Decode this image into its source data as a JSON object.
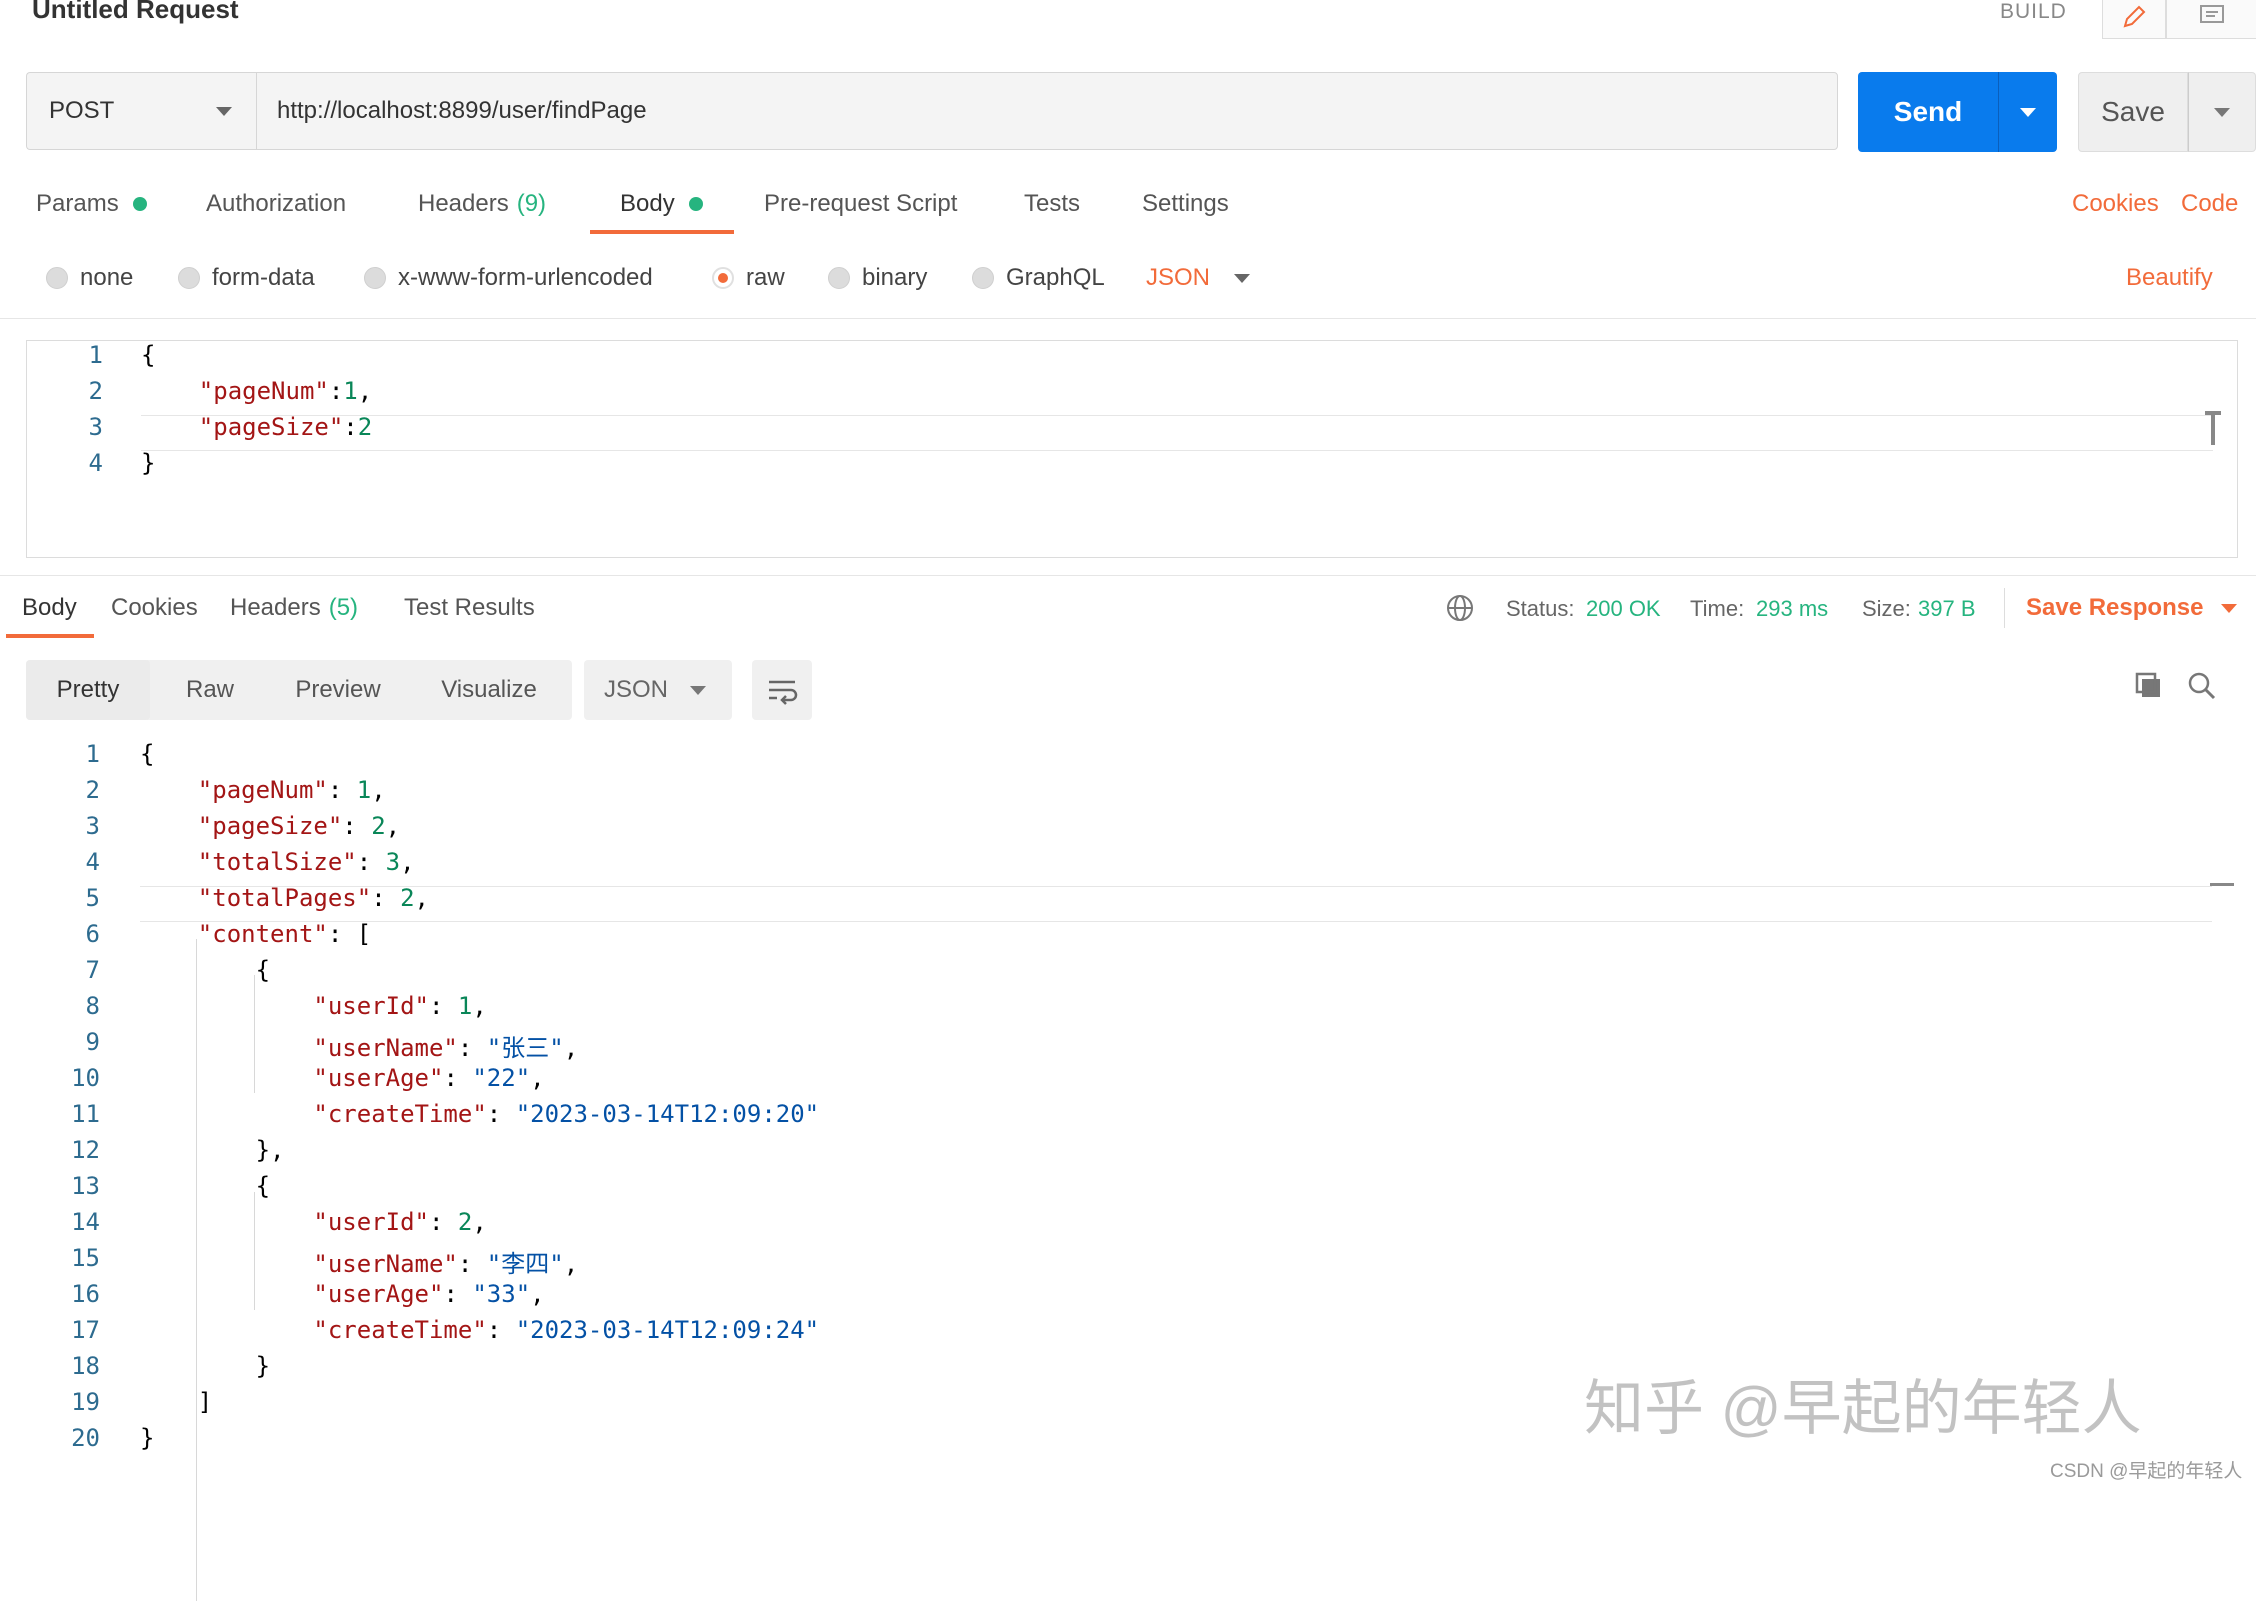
{
  "header": {
    "title": "Untitled Request",
    "mode": "BUILD",
    "edit_icon": "pencil-icon",
    "comment_icon": "comment-icon"
  },
  "request": {
    "method": "POST",
    "url": "http://localhost:8899/user/findPage",
    "send_label": "Send",
    "save_label": "Save"
  },
  "request_tabs": [
    {
      "label": "Params",
      "indicator": "dot"
    },
    {
      "label": "Authorization"
    },
    {
      "label": "Headers",
      "count": "(9)"
    },
    {
      "label": "Body",
      "indicator": "dot",
      "active": true
    },
    {
      "label": "Pre-request Script"
    },
    {
      "label": "Tests"
    },
    {
      "label": "Settings"
    }
  ],
  "request_links": {
    "cookies": "Cookies",
    "code": "Code"
  },
  "body_types": {
    "options": [
      "none",
      "form-data",
      "x-www-form-urlencoded",
      "raw",
      "binary",
      "GraphQL"
    ],
    "selected": "raw",
    "format": "JSON",
    "beautify": "Beautify"
  },
  "request_body_lines": [
    {
      "no": "1",
      "parts": [
        {
          "t": "p",
          "v": "{"
        }
      ]
    },
    {
      "no": "2",
      "parts": [
        {
          "t": "p",
          "v": "    "
        },
        {
          "t": "k",
          "v": "\"pageNum\""
        },
        {
          "t": "p",
          "v": ":"
        },
        {
          "t": "n",
          "v": "1"
        },
        {
          "t": "p",
          "v": ","
        }
      ]
    },
    {
      "no": "3",
      "parts": [
        {
          "t": "p",
          "v": "    "
        },
        {
          "t": "k",
          "v": "\"pageSize\""
        },
        {
          "t": "p",
          "v": ":"
        },
        {
          "t": "n",
          "v": "2"
        }
      ]
    },
    {
      "no": "4",
      "parts": [
        {
          "t": "p",
          "v": "}"
        }
      ]
    }
  ],
  "response_tabs": [
    {
      "label": "Body",
      "active": true
    },
    {
      "label": "Cookies"
    },
    {
      "label": "Headers",
      "count": "(5)"
    },
    {
      "label": "Test Results"
    }
  ],
  "response_status": {
    "status_label": "Status:",
    "status": "200 OK",
    "time_label": "Time:",
    "time": "293 ms",
    "size_label": "Size:",
    "size": "397 B",
    "save_response": "Save Response"
  },
  "response_view": {
    "modes": [
      "Pretty",
      "Raw",
      "Preview",
      "Visualize"
    ],
    "selected": "Pretty",
    "format": "JSON"
  },
  "response_body_lines": [
    {
      "no": "1",
      "parts": [
        {
          "t": "p",
          "v": "{"
        }
      ]
    },
    {
      "no": "2",
      "parts": [
        {
          "t": "p",
          "v": "    "
        },
        {
          "t": "k",
          "v": "\"pageNum\""
        },
        {
          "t": "p",
          "v": ": "
        },
        {
          "t": "n",
          "v": "1"
        },
        {
          "t": "p",
          "v": ","
        }
      ]
    },
    {
      "no": "3",
      "parts": [
        {
          "t": "p",
          "v": "    "
        },
        {
          "t": "k",
          "v": "\"pageSize\""
        },
        {
          "t": "p",
          "v": ": "
        },
        {
          "t": "n",
          "v": "2"
        },
        {
          "t": "p",
          "v": ","
        }
      ]
    },
    {
      "no": "4",
      "parts": [
        {
          "t": "p",
          "v": "    "
        },
        {
          "t": "k",
          "v": "\"totalSize\""
        },
        {
          "t": "p",
          "v": ": "
        },
        {
          "t": "n",
          "v": "3"
        },
        {
          "t": "p",
          "v": ","
        }
      ]
    },
    {
      "no": "5",
      "parts": [
        {
          "t": "p",
          "v": "    "
        },
        {
          "t": "k",
          "v": "\"totalPages\""
        },
        {
          "t": "p",
          "v": ": "
        },
        {
          "t": "n",
          "v": "2"
        },
        {
          "t": "p",
          "v": ","
        }
      ]
    },
    {
      "no": "6",
      "parts": [
        {
          "t": "p",
          "v": "    "
        },
        {
          "t": "k",
          "v": "\"content\""
        },
        {
          "t": "p",
          "v": ": ["
        }
      ]
    },
    {
      "no": "7",
      "parts": [
        {
          "t": "p",
          "v": "        {"
        }
      ]
    },
    {
      "no": "8",
      "parts": [
        {
          "t": "p",
          "v": "            "
        },
        {
          "t": "k",
          "v": "\"userId\""
        },
        {
          "t": "p",
          "v": ": "
        },
        {
          "t": "n",
          "v": "1"
        },
        {
          "t": "p",
          "v": ","
        }
      ]
    },
    {
      "no": "9",
      "parts": [
        {
          "t": "p",
          "v": "            "
        },
        {
          "t": "k",
          "v": "\"userName\""
        },
        {
          "t": "p",
          "v": ": "
        },
        {
          "t": "s",
          "v": "\"张三\""
        },
        {
          "t": "p",
          "v": ","
        }
      ]
    },
    {
      "no": "10",
      "parts": [
        {
          "t": "p",
          "v": "            "
        },
        {
          "t": "k",
          "v": "\"userAge\""
        },
        {
          "t": "p",
          "v": ": "
        },
        {
          "t": "s",
          "v": "\"22\""
        },
        {
          "t": "p",
          "v": ","
        }
      ]
    },
    {
      "no": "11",
      "parts": [
        {
          "t": "p",
          "v": "            "
        },
        {
          "t": "k",
          "v": "\"createTime\""
        },
        {
          "t": "p",
          "v": ": "
        },
        {
          "t": "s",
          "v": "\"2023-03-14T12:09:20\""
        }
      ]
    },
    {
      "no": "12",
      "parts": [
        {
          "t": "p",
          "v": "        },"
        }
      ]
    },
    {
      "no": "13",
      "parts": [
        {
          "t": "p",
          "v": "        {"
        }
      ]
    },
    {
      "no": "14",
      "parts": [
        {
          "t": "p",
          "v": "            "
        },
        {
          "t": "k",
          "v": "\"userId\""
        },
        {
          "t": "p",
          "v": ": "
        },
        {
          "t": "n",
          "v": "2"
        },
        {
          "t": "p",
          "v": ","
        }
      ]
    },
    {
      "no": "15",
      "parts": [
        {
          "t": "p",
          "v": "            "
        },
        {
          "t": "k",
          "v": "\"userName\""
        },
        {
          "t": "p",
          "v": ": "
        },
        {
          "t": "s",
          "v": "\"李四\""
        },
        {
          "t": "p",
          "v": ","
        }
      ]
    },
    {
      "no": "16",
      "parts": [
        {
          "t": "p",
          "v": "            "
        },
        {
          "t": "k",
          "v": "\"userAge\""
        },
        {
          "t": "p",
          "v": ": "
        },
        {
          "t": "s",
          "v": "\"33\""
        },
        {
          "t": "p",
          "v": ","
        }
      ]
    },
    {
      "no": "17",
      "parts": [
        {
          "t": "p",
          "v": "            "
        },
        {
          "t": "k",
          "v": "\"createTime\""
        },
        {
          "t": "p",
          "v": ": "
        },
        {
          "t": "s",
          "v": "\"2023-03-14T12:09:24\""
        }
      ]
    },
    {
      "no": "18",
      "parts": [
        {
          "t": "p",
          "v": "        }"
        }
      ]
    },
    {
      "no": "19",
      "parts": [
        {
          "t": "p",
          "v": "    ]"
        }
      ]
    },
    {
      "no": "20",
      "parts": [
        {
          "t": "p",
          "v": "}"
        }
      ]
    }
  ],
  "watermark": {
    "main": "知乎 @早起的年轻人",
    "small": "CSDN @早起的年轻人"
  },
  "colors": {
    "accent": "#f26b3a",
    "primary": "#097bed",
    "success": "#26b47f"
  }
}
